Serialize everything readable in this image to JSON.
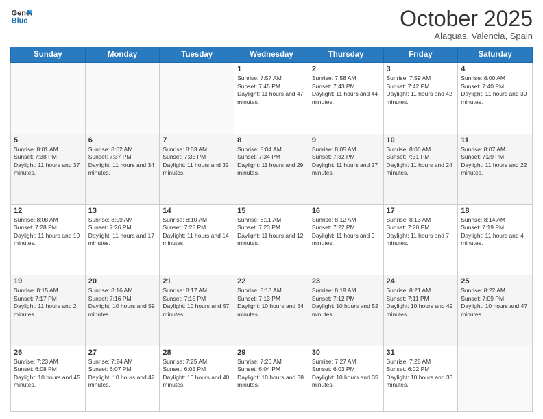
{
  "header": {
    "logo_line1": "General",
    "logo_line2": "Blue",
    "month": "October 2025",
    "location": "Alaquas, Valencia, Spain"
  },
  "days_of_week": [
    "Sunday",
    "Monday",
    "Tuesday",
    "Wednesday",
    "Thursday",
    "Friday",
    "Saturday"
  ],
  "weeks": [
    [
      {
        "day": "",
        "info": ""
      },
      {
        "day": "",
        "info": ""
      },
      {
        "day": "",
        "info": ""
      },
      {
        "day": "1",
        "info": "Sunrise: 7:57 AM\nSunset: 7:45 PM\nDaylight: 11 hours and 47 minutes."
      },
      {
        "day": "2",
        "info": "Sunrise: 7:58 AM\nSunset: 7:43 PM\nDaylight: 11 hours and 44 minutes."
      },
      {
        "day": "3",
        "info": "Sunrise: 7:59 AM\nSunset: 7:42 PM\nDaylight: 11 hours and 42 minutes."
      },
      {
        "day": "4",
        "info": "Sunrise: 8:00 AM\nSunset: 7:40 PM\nDaylight: 11 hours and 39 minutes."
      }
    ],
    [
      {
        "day": "5",
        "info": "Sunrise: 8:01 AM\nSunset: 7:38 PM\nDaylight: 11 hours and 37 minutes."
      },
      {
        "day": "6",
        "info": "Sunrise: 8:02 AM\nSunset: 7:37 PM\nDaylight: 11 hours and 34 minutes."
      },
      {
        "day": "7",
        "info": "Sunrise: 8:03 AM\nSunset: 7:35 PM\nDaylight: 11 hours and 32 minutes."
      },
      {
        "day": "8",
        "info": "Sunrise: 8:04 AM\nSunset: 7:34 PM\nDaylight: 11 hours and 29 minutes."
      },
      {
        "day": "9",
        "info": "Sunrise: 8:05 AM\nSunset: 7:32 PM\nDaylight: 11 hours and 27 minutes."
      },
      {
        "day": "10",
        "info": "Sunrise: 8:06 AM\nSunset: 7:31 PM\nDaylight: 11 hours and 24 minutes."
      },
      {
        "day": "11",
        "info": "Sunrise: 8:07 AM\nSunset: 7:29 PM\nDaylight: 11 hours and 22 minutes."
      }
    ],
    [
      {
        "day": "12",
        "info": "Sunrise: 8:08 AM\nSunset: 7:28 PM\nDaylight: 11 hours and 19 minutes."
      },
      {
        "day": "13",
        "info": "Sunrise: 8:09 AM\nSunset: 7:26 PM\nDaylight: 11 hours and 17 minutes."
      },
      {
        "day": "14",
        "info": "Sunrise: 8:10 AM\nSunset: 7:25 PM\nDaylight: 11 hours and 14 minutes."
      },
      {
        "day": "15",
        "info": "Sunrise: 8:11 AM\nSunset: 7:23 PM\nDaylight: 11 hours and 12 minutes."
      },
      {
        "day": "16",
        "info": "Sunrise: 8:12 AM\nSunset: 7:22 PM\nDaylight: 11 hours and 9 minutes."
      },
      {
        "day": "17",
        "info": "Sunrise: 8:13 AM\nSunset: 7:20 PM\nDaylight: 11 hours and 7 minutes."
      },
      {
        "day": "18",
        "info": "Sunrise: 8:14 AM\nSunset: 7:19 PM\nDaylight: 11 hours and 4 minutes."
      }
    ],
    [
      {
        "day": "19",
        "info": "Sunrise: 8:15 AM\nSunset: 7:17 PM\nDaylight: 11 hours and 2 minutes."
      },
      {
        "day": "20",
        "info": "Sunrise: 8:16 AM\nSunset: 7:16 PM\nDaylight: 10 hours and 59 minutes."
      },
      {
        "day": "21",
        "info": "Sunrise: 8:17 AM\nSunset: 7:15 PM\nDaylight: 10 hours and 57 minutes."
      },
      {
        "day": "22",
        "info": "Sunrise: 8:18 AM\nSunset: 7:13 PM\nDaylight: 10 hours and 54 minutes."
      },
      {
        "day": "23",
        "info": "Sunrise: 8:19 AM\nSunset: 7:12 PM\nDaylight: 10 hours and 52 minutes."
      },
      {
        "day": "24",
        "info": "Sunrise: 8:21 AM\nSunset: 7:11 PM\nDaylight: 10 hours and 49 minutes."
      },
      {
        "day": "25",
        "info": "Sunrise: 8:22 AM\nSunset: 7:09 PM\nDaylight: 10 hours and 47 minutes."
      }
    ],
    [
      {
        "day": "26",
        "info": "Sunrise: 7:23 AM\nSunset: 6:08 PM\nDaylight: 10 hours and 45 minutes."
      },
      {
        "day": "27",
        "info": "Sunrise: 7:24 AM\nSunset: 6:07 PM\nDaylight: 10 hours and 42 minutes."
      },
      {
        "day": "28",
        "info": "Sunrise: 7:25 AM\nSunset: 6:05 PM\nDaylight: 10 hours and 40 minutes."
      },
      {
        "day": "29",
        "info": "Sunrise: 7:26 AM\nSunset: 6:04 PM\nDaylight: 10 hours and 38 minutes."
      },
      {
        "day": "30",
        "info": "Sunrise: 7:27 AM\nSunset: 6:03 PM\nDaylight: 10 hours and 35 minutes."
      },
      {
        "day": "31",
        "info": "Sunrise: 7:28 AM\nSunset: 6:02 PM\nDaylight: 10 hours and 33 minutes."
      },
      {
        "day": "",
        "info": ""
      }
    ]
  ]
}
